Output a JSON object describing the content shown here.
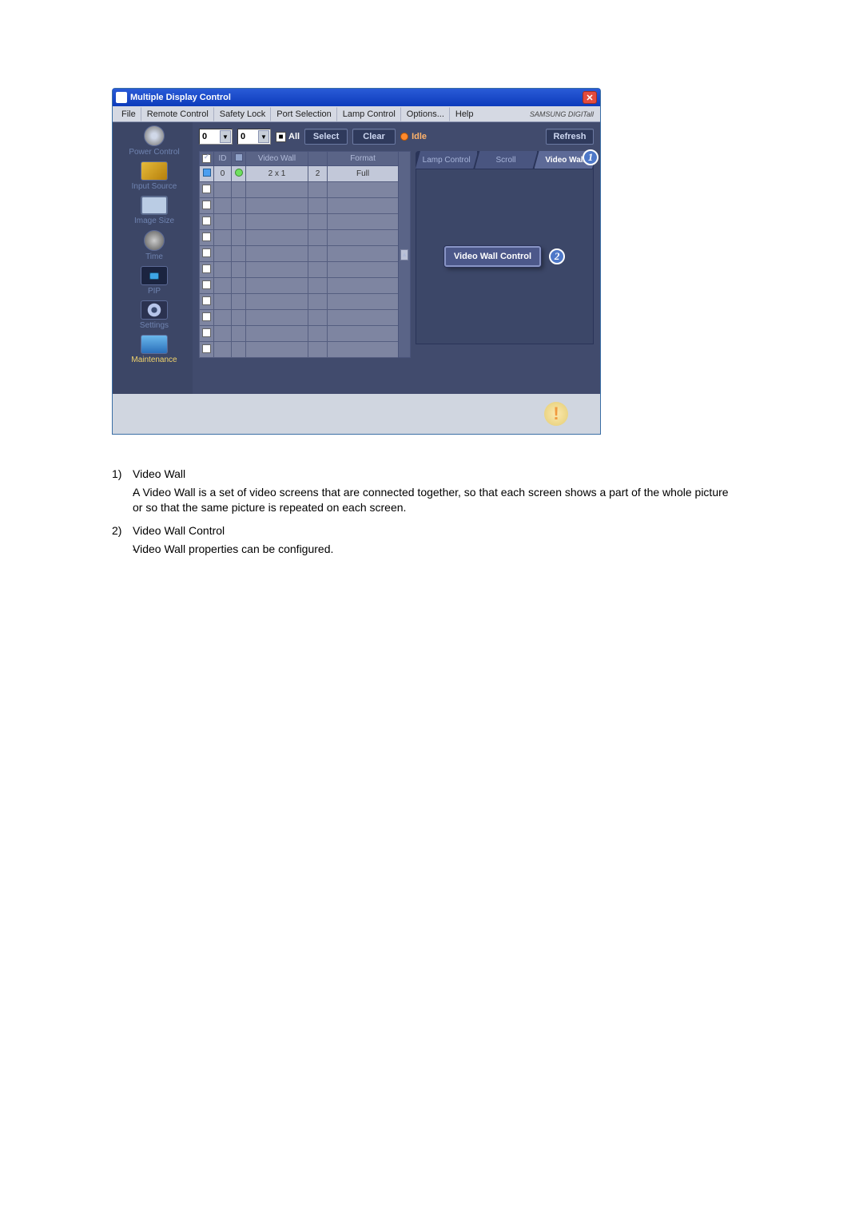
{
  "window": {
    "title": "Multiple Display Control",
    "close_x": "✕"
  },
  "menu": {
    "file": "File",
    "remote": "Remote Control",
    "safety": "Safety Lock",
    "port": "Port Selection",
    "lamp": "Lamp Control",
    "options": "Options...",
    "help": "Help",
    "brand": "SAMSUNG DIGITall"
  },
  "sidebar": [
    {
      "id": "power",
      "label": "Power Control"
    },
    {
      "id": "source",
      "label": "Input Source"
    },
    {
      "id": "size",
      "label": "Image Size"
    },
    {
      "id": "time",
      "label": "Time"
    },
    {
      "id": "pip",
      "label": "PIP"
    },
    {
      "id": "settings",
      "label": "Settings"
    },
    {
      "id": "maint",
      "label": "Maintenance",
      "active": true
    }
  ],
  "toolbar": {
    "sel1": "0",
    "sel2": "0",
    "all_check": "■",
    "all_label": "All",
    "select": "Select",
    "clear": "Clear",
    "idle": "Idle",
    "refresh": "Refresh"
  },
  "table": {
    "headers": {
      "chk": "☑",
      "id": "ID",
      "status": "",
      "videowall": "Video Wall",
      "num": "",
      "format": "Format"
    },
    "row": {
      "id": "0",
      "vw": "2 x 1",
      "n": "2",
      "fmt": "Full"
    }
  },
  "tabs": {
    "lamp": "Lamp Control",
    "scroll": "Scroll",
    "videowall": "Video Wall"
  },
  "panel": {
    "button": "Video Wall Control"
  },
  "callouts": {
    "one": "1",
    "two": "2"
  },
  "status": {
    "warn": "!"
  },
  "desc": {
    "n1": "1)",
    "t1": "Video Wall",
    "s1": "A Video Wall is a set of video screens that are connected together, so that each screen shows a part of the whole picture or so that the same picture is repeated on each screen.",
    "n2": "2)",
    "t2": "Video Wall Control",
    "s2": "Video Wall properties can be configured."
  }
}
